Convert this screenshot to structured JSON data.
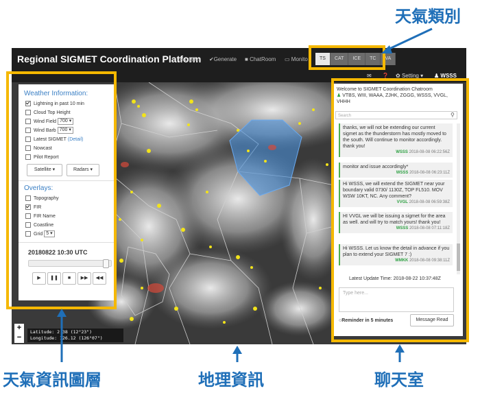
{
  "annotations": {
    "weather_types": "天氣類別",
    "weather_layers": "天氣資訊圖層",
    "geo_info": "地理資訊",
    "chatroom": "聊天室"
  },
  "navbar": {
    "brand": "Regional SIGMET Coordination Platform",
    "links": [
      "Layers",
      "Generate",
      "ChatRoom",
      "Monito"
    ],
    "phenomena": [
      "TS",
      "CAT",
      "ICE",
      "TC",
      "VA"
    ],
    "active_phenomenon": "TS",
    "setting_label": "Setting",
    "user_label": "WSSS"
  },
  "weather_panel": {
    "title": "Weather Information:",
    "items": [
      {
        "label": "Lightning in past 10 min",
        "checked": true
      },
      {
        "label": "Cloud Top Height",
        "checked": false
      },
      {
        "label": "Wind Field",
        "checked": false,
        "select": "700"
      },
      {
        "label": "Wind Barb",
        "checked": false,
        "select": "700"
      },
      {
        "label": "Latest SIGMET",
        "checked": false,
        "link": "(Detail)"
      },
      {
        "label": "Nowcast",
        "checked": false
      },
      {
        "label": "Pilot Report",
        "checked": false
      }
    ],
    "satellite_label": "Satellite",
    "radars_label": "Radars",
    "overlays_title": "Overlays:",
    "overlays": [
      {
        "label": "Topography",
        "checked": false
      },
      {
        "label": "FIR",
        "checked": true
      },
      {
        "label": "FIR Name",
        "checked": false
      },
      {
        "label": "Coastline",
        "checked": false
      },
      {
        "label": "Grid",
        "checked": false,
        "select": "5"
      }
    ],
    "time": "20180822 10:30 UTC",
    "time_slider_fraction": 0.96
  },
  "chat": {
    "welcome": "Welcome to SIGMET Coordination Chatroom",
    "participants": "VTBS, WIII, WAAA, ZJHK, ZGGG, WSSS, VVGL, VHHH",
    "search_placeholder": "Search",
    "messages": [
      {
        "text": "thanks, we will not be extending our current sigmet as the thunderstorm has mostly moved to the south. Will continue to monitor accordingly. thank you!",
        "sender": "WSSS",
        "time": "2018-08-08 06:22:56Z"
      },
      {
        "text": "monitor and issue accordingly*",
        "sender": "WSSS",
        "time": "2018-08-08 06:23:11Z"
      },
      {
        "text": "Hi WSSS, we will extend the SIGMET near your boundary valid 0730/ 1130Z, TOP FL510. MOV WSW 10KT, NC. Any comment?",
        "sender": "VVGL",
        "time": "2018-08-08 06:59:38Z"
      },
      {
        "text": "HI VVGL we will be issuing a sigmet for the area as well. and will try to match yours! thank you!",
        "sender": "WSSS",
        "time": "2018-08-08 07:11:18Z"
      },
      {
        "text": "Hi WSSS. Let us know the detail in advance if you plan to extend your SIGMET 7 :)",
        "sender": "WMKK",
        "time": "2018-08-08 09:38:11Z"
      }
    ],
    "update_time": "Latest Update Time: 2018-08-22 10:37:48Z",
    "input_placeholder": "Type here...",
    "reminder_label": "Reminder in 5 minutes",
    "read_button": "Message Read"
  },
  "map": {
    "latitude_readout": "Latitude:  2.38 (12°23\")",
    "longitude_readout": "Longitude: 126.12 (126°07\")",
    "zoom_in": "+",
    "zoom_out": "−"
  },
  "colors": {
    "annotation_box": "#f5b800",
    "annotation_text": "#1f6fb8",
    "navbar": "#1e1e1e",
    "accent": "#3a7fc4",
    "online": "#2ea043"
  }
}
